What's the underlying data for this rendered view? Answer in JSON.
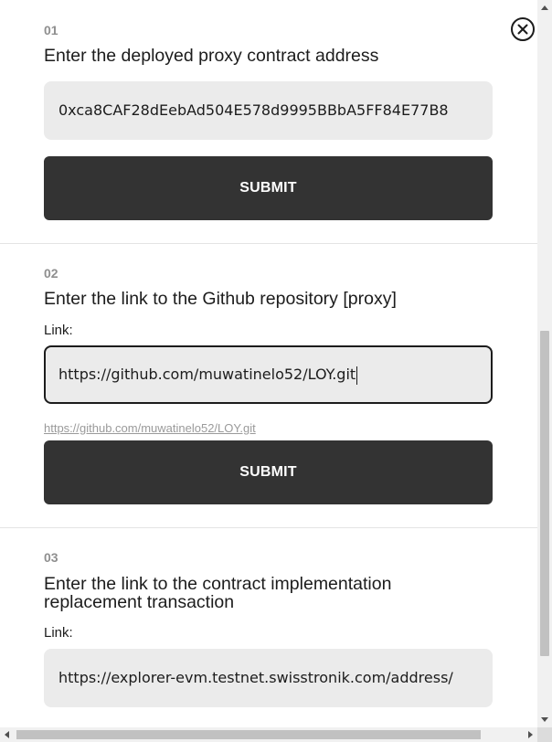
{
  "close": {
    "icon": "close-circle-icon"
  },
  "steps": [
    {
      "number": "01",
      "title": "Enter the deployed proxy contract address",
      "input_value": "0xca8CAF28dEebAd504E578d9995BBbA5FF84E77B8",
      "submit_label": "SUBMIT"
    },
    {
      "number": "02",
      "title": "Enter the link to the Github repository [proxy]",
      "link_label": "Link:",
      "input_value": "https://github.com/muwatinelo52/LOY.git",
      "preview_link": "https://github.com/muwatinelo52/LOY.git",
      "submit_label": "SUBMIT"
    },
    {
      "number": "03",
      "title": "Enter the link to the contract implementation replacement transaction",
      "link_label": "Link:",
      "input_value": "https://explorer-evm.testnet.swisstronik.com/address/"
    }
  ],
  "colors": {
    "button_bg": "#333333",
    "field_bg": "#ebebeb",
    "step_number": "#8f8f8f",
    "link_preview": "#9a9a9a"
  }
}
